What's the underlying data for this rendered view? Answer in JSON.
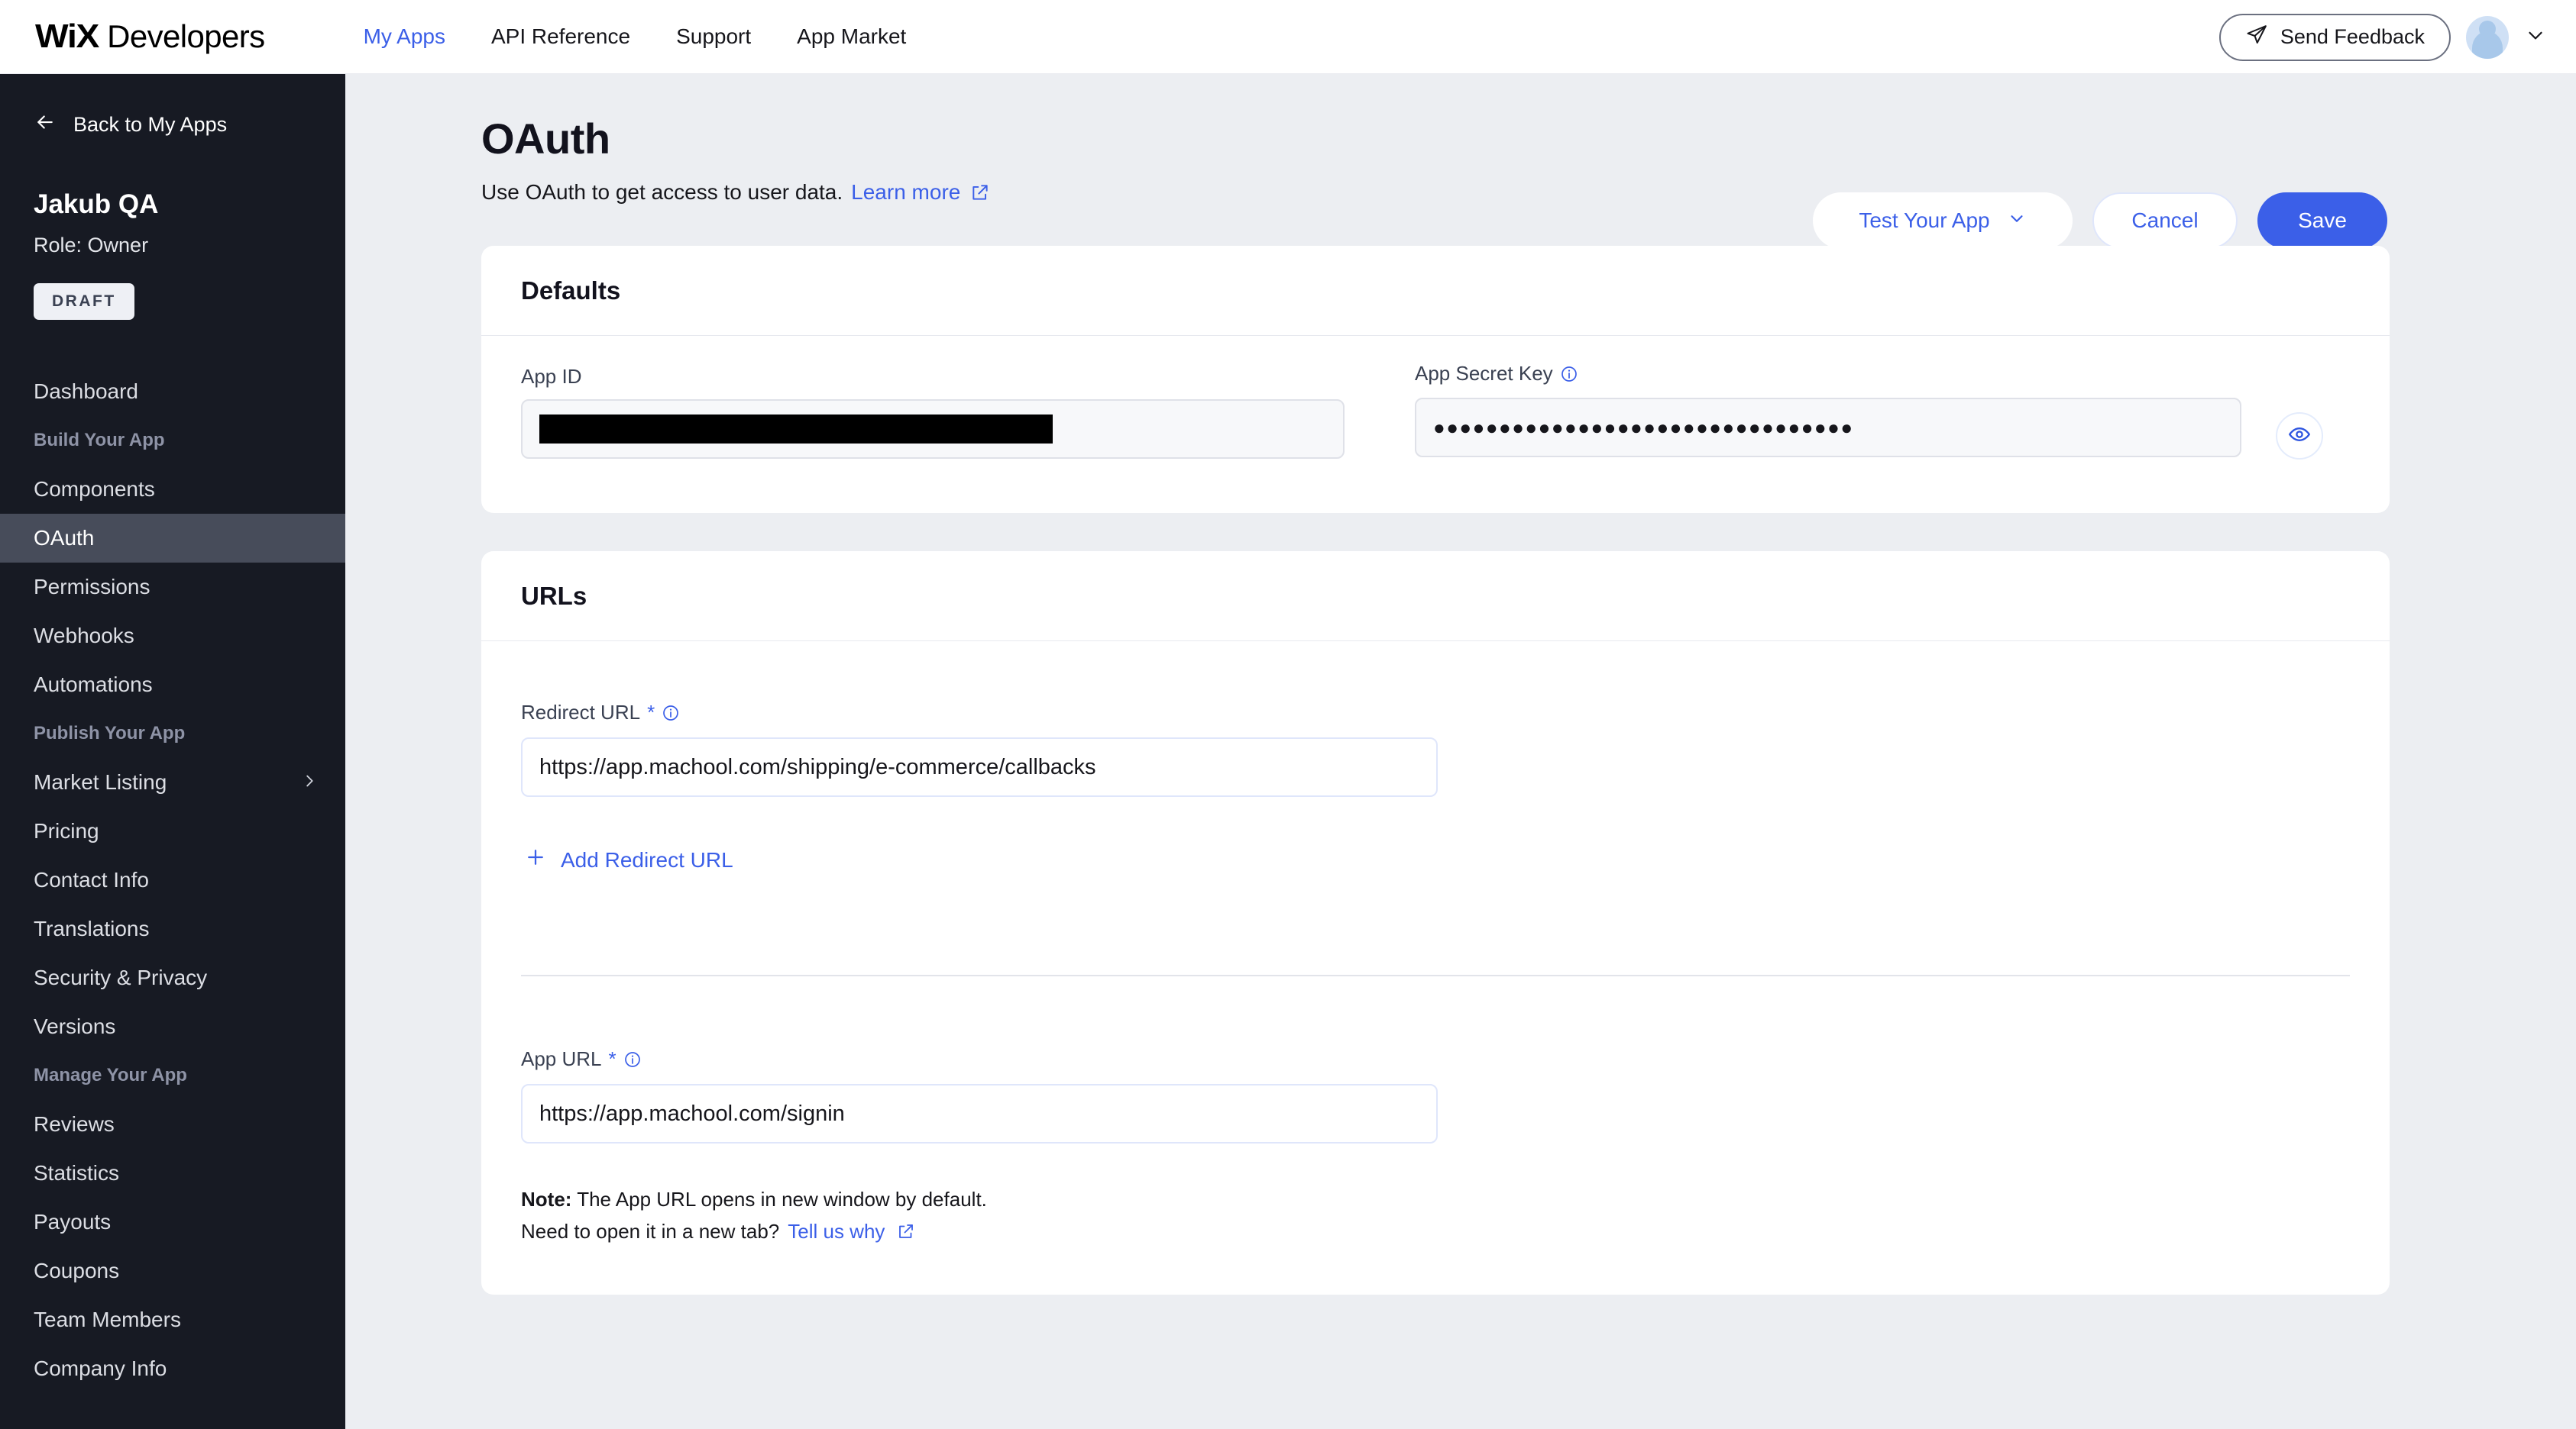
{
  "topbar": {
    "brand_wix": "WiX",
    "brand_developers": "Developers",
    "nav": [
      {
        "label": "My Apps",
        "active": true
      },
      {
        "label": "API Reference",
        "active": false
      },
      {
        "label": "Support",
        "active": false
      },
      {
        "label": "App Market",
        "active": false
      }
    ],
    "feedback_label": "Send Feedback",
    "feedback_icon": "send-icon",
    "avatar_icon": "avatar-icon",
    "user_menu_icon": "chevron-down-icon"
  },
  "sidebar": {
    "back_label": "Back to My Apps",
    "back_icon": "arrow-left-icon",
    "app_name": "Jakub QA",
    "role": "Role: Owner",
    "status_badge": "DRAFT",
    "items": [
      {
        "label": "Dashboard",
        "type": "item",
        "active": false
      },
      {
        "label": "Build Your App",
        "type": "group"
      },
      {
        "label": "Components",
        "type": "item",
        "active": false
      },
      {
        "label": "OAuth",
        "type": "item",
        "active": true
      },
      {
        "label": "Permissions",
        "type": "item",
        "active": false
      },
      {
        "label": "Webhooks",
        "type": "item",
        "active": false
      },
      {
        "label": "Automations",
        "type": "item",
        "active": false
      },
      {
        "label": "Publish Your App",
        "type": "group"
      },
      {
        "label": "Market Listing",
        "type": "item",
        "active": false,
        "chevron": "›"
      },
      {
        "label": "Pricing",
        "type": "item",
        "active": false
      },
      {
        "label": "Contact Info",
        "type": "item",
        "active": false
      },
      {
        "label": "Translations",
        "type": "item",
        "active": false
      },
      {
        "label": "Security & Privacy",
        "type": "item",
        "active": false
      },
      {
        "label": "Versions",
        "type": "item",
        "active": false
      },
      {
        "label": "Manage Your App",
        "type": "group"
      },
      {
        "label": "Reviews",
        "type": "item",
        "active": false
      },
      {
        "label": "Statistics",
        "type": "item",
        "active": false
      },
      {
        "label": "Payouts",
        "type": "item",
        "active": false
      },
      {
        "label": "Coupons",
        "type": "item",
        "active": false
      },
      {
        "label": "Team Members",
        "type": "item",
        "active": false
      },
      {
        "label": "Company Info",
        "type": "item",
        "active": false
      }
    ]
  },
  "page": {
    "title": "OAuth",
    "subtitle_text": "Use OAuth to get access to user data.",
    "subtitle_link": "Learn more",
    "subtitle_link_icon": "external-link-icon"
  },
  "actions": {
    "test_label": "Test Your App",
    "test_icon": "chevron-down-icon",
    "cancel_label": "Cancel",
    "save_label": "Save"
  },
  "defaults": {
    "card_title": "Defaults",
    "app_id_label": "App ID",
    "app_id_value": "",
    "app_id_redacted": true,
    "copy_icon": "copy-icon",
    "secret_label": "App Secret Key",
    "secret_info_icon": "info-icon",
    "secret_value": "●●●●●●●●●●●●●●●●●●●●●●●●●●●●●●●●",
    "reveal_icon": "eye-icon"
  },
  "urls": {
    "card_title": "URLs",
    "redirect_label": "Redirect URL",
    "redirect_required": "*",
    "redirect_info_icon": "info-icon",
    "redirect_value": "https://app.machool.com/shipping/e-commerce/callbacks",
    "add_redirect_label": "Add Redirect URL",
    "add_icon": "plus-icon",
    "app_url_label": "App URL",
    "app_url_required": "*",
    "app_url_info_icon": "info-icon",
    "app_url_value": "https://app.machool.com/signin",
    "note_prefix": "Note:",
    "note_line1": " The App URL opens in new window by default.",
    "note_line2": "Need to open it in a new tab?",
    "note_link": "Tell us why",
    "note_link_icon": "external-link-icon"
  },
  "colors": {
    "accent": "#3b5fe8",
    "sidebar_bg": "#171a23",
    "sidebar_active": "#474c5a",
    "page_bg": "#eceef2"
  }
}
